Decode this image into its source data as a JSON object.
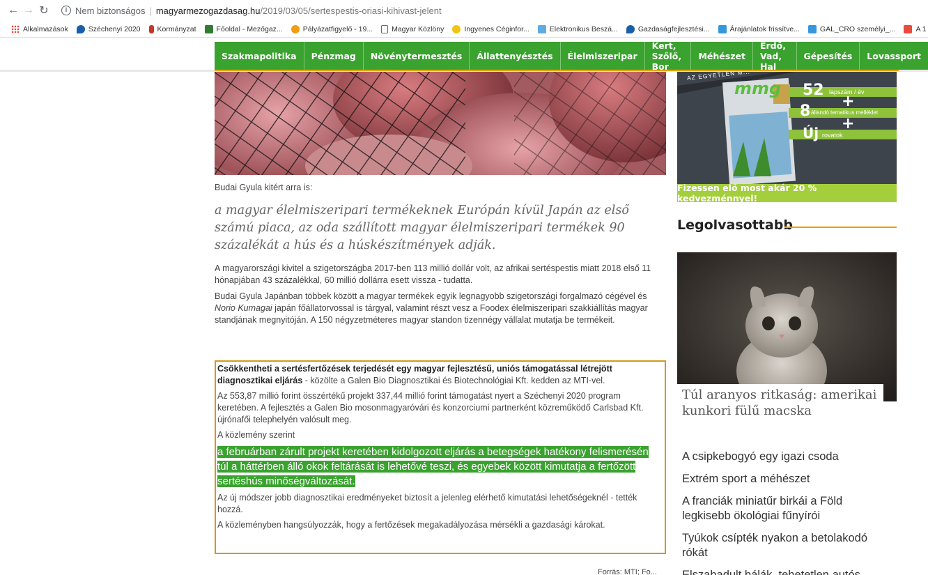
{
  "browser": {
    "security_label": "Nem biztonságos",
    "url_host": "magyarmezogazdasag.hu",
    "url_path": "/2019/03/05/sertespestis-oriasi-kihivast-jelent",
    "bookmarks": [
      {
        "label": "Alkalmazások",
        "color": "#e8453c"
      },
      {
        "label": "Széchenyi 2020",
        "color": "#1a5ea8"
      },
      {
        "label": "Kormányzat",
        "color": "#c0392b"
      },
      {
        "label": "Főoldal - Mezőgaz...",
        "color": "#2e7d32"
      },
      {
        "label": "Pályázatfigyelő - 19...",
        "color": "#f39c12"
      },
      {
        "label": "Magyar Közlöny",
        "color": "#666666"
      },
      {
        "label": "Ingyenes Céginfor...",
        "color": "#f1c40f"
      },
      {
        "label": "Elektronikus Beszá...",
        "color": "#5dade2"
      },
      {
        "label": "Gazdaságfejlesztési...",
        "color": "#1a5ea8"
      },
      {
        "label": "Árajánlatok frissítve...",
        "color": "#3498db"
      },
      {
        "label": "GAL_CRO személyi_...",
        "color": "#3498db"
      },
      {
        "label": "A 1",
        "color": "#e74c3c"
      }
    ]
  },
  "nav": {
    "items": [
      "Szakmapolitika",
      "Pénzmag",
      "Növénytermesztés",
      "Állattenyésztés",
      "Élelmiszeripar",
      "Kert, Szőlő, Bor",
      "Méhészet",
      "Erdő, Vad, Hal",
      "Gépesítés",
      "Lovassport"
    ]
  },
  "article": {
    "caption": "Budai Gyula kitért arra is:",
    "quote": "a magyar élelmiszeripari termékeknek Európán kívül Japán az első számú piaca, az oda szállított magyar élelmiszeripari termékek 90 százalékát a hús és a húskészítmények adják.",
    "para1": "A magyarországi kivitel a szigetországba 2017-ben 113 millió dollár volt, az afrikai sertéspestis miatt 2018 első 11 hónapjában 43 százalékkal, 60 millió dollárra esett vissza - tudatta.",
    "para2_a": "Budai Gyula Japánban többek között a magyar termékek egyik legnagyobb szigetországi forgalmazó cégével és ",
    "para2_em": "Norio Kumagai",
    "para2_b": " japán főállatorvossal is tárgyal, valamint részt vesz a Foodex élelmiszeripari szakkiállítás magyar standjának megnyitóján. A 150 négyzetméteres magyar standon tizennégy vállalat mutatja be termékeit.",
    "box": {
      "lead_bold": "Csökkentheti a sertésfertőzések terjedését egy magyar fejlesztésű, uniós támogatással létrejött diagnosztikai eljárás",
      "lead_rest": " - közölte a Galen Bio Diagnosztikai és Biotechnológiai Kft. kedden az MTI-vel.",
      "p2": "Az 553,87 millió forint összértékű projekt 337,44 millió forint támogatást nyert a Széchenyi 2020 program keretében. A fejlesztés a Galen Bio mosonmagyaróvári és konzorciumi partnerként közreműködő Carlsbad Kft. újrónafői telephelyén valósult meg.",
      "p3": "A közlemény szerint",
      "highlight": "a februárban zárult projekt keretében kidolgozott eljárás a betegségek hatékony felismerésén túl a háttérben álló okok feltárását is lehetővé teszi, és egyebek között kimutatja a fertőzött sertéshús minőségváltozását.",
      "p5": "Az új módszer jobb diagnosztikai eredményeket biztosít a jelenleg elérhető kimutatási lehetőségeknél - tették hozzá.",
      "p6": "A közleményben hangsúlyozzák, hogy a fertőzések megakadályozása mérsékli a gazdasági károkat."
    },
    "source": "Forrás: MTI; Fo..."
  },
  "sidebar": {
    "ad": {
      "banner_top": "AZ EGYETLEN M...",
      "logo": "mmg",
      "num1": "52",
      "text1": "lapszám / év",
      "num2": "8",
      "text2": "állandó tematikus melléklet",
      "num3": "Új",
      "text3": "rovatok",
      "cta": "Fizessen elő most akár 20 % kedvezménnyel!"
    },
    "section_title": "Legolvasottabb",
    "featured_caption": "Túl aranyos ritkaság: amerikai kunkori fülű macska",
    "list": [
      "A csipkebogyó egy igazi csoda",
      "Extrém sport a méhészet",
      "A franciák miniatűr birkái a Föld legkisebb ökológiai fűnyírói",
      "Tyúkok csípték nyakon a betolakodó rókát",
      "Elszabadult bálák, tehetetlen autós"
    ]
  }
}
